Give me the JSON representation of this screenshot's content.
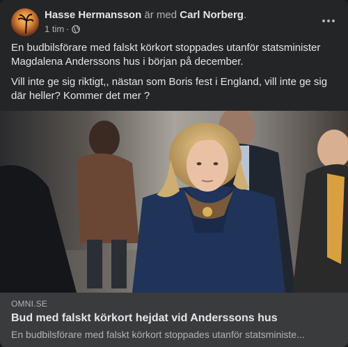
{
  "post": {
    "author_name": "Hasse Hermansson",
    "with_text": "är med",
    "tagged_name": "Carl Norberg",
    "tagged_suffix": ".",
    "time": "1 tim",
    "separator": "·",
    "privacy_icon": "globe-icon",
    "paragraphs": [
      "En budbilsförare med falskt körkort stoppades utanför statsminister Magdalena Anderssons hus i början på december.",
      "Vill inte ge sig riktigt,, nästan som Boris fest i England, vill inte ge sig där heller? Kommer det mer ?"
    ]
  },
  "link_preview": {
    "domain": "OMNI.SE",
    "title": "Bud med falskt körkort hejdat vid Anderssons hus",
    "description": "En budbilsförare med falskt körkort stoppades utanför statsministe..."
  },
  "colors": {
    "background": "#242526",
    "preview_background": "#3a3b3c",
    "primary_text": "#e4e6eb",
    "secondary_text": "#b0b3b8"
  }
}
